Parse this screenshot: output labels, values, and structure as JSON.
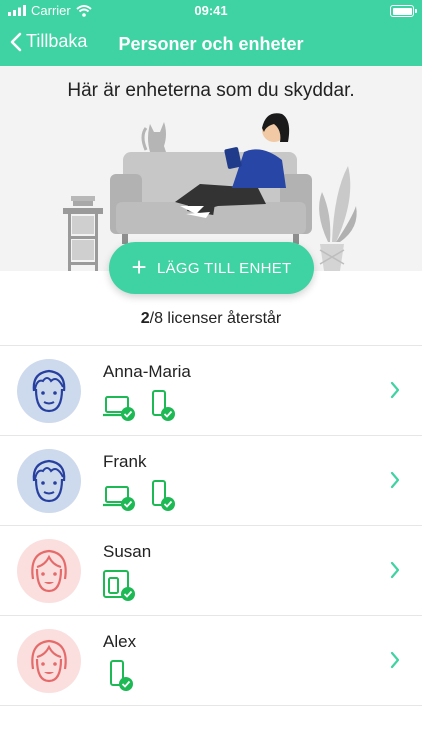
{
  "status": {
    "carrier": "Carrier",
    "time": "09:41"
  },
  "nav": {
    "back_label": "Tillbaka",
    "title": "Personer och enheter"
  },
  "hero": {
    "title": "Här är enheterna som du skyddar."
  },
  "add_button": {
    "label": "LÄGG TILL ENHET"
  },
  "licenses": {
    "used": "2",
    "rest": "/8 licenser återstår"
  },
  "colors": {
    "accent": "#3fd2a2",
    "device_green": "#1db954",
    "chevron": "#3fd2a2"
  },
  "people": [
    {
      "name": "Anna-Maria",
      "avatar": "male-avatar",
      "devices": [
        "laptop-icon",
        "phone-icon"
      ]
    },
    {
      "name": "Frank",
      "avatar": "male-avatar",
      "devices": [
        "laptop-icon",
        "phone-icon"
      ]
    },
    {
      "name": "Susan",
      "avatar": "female-avatar",
      "devices": [
        "multi-device-icon"
      ]
    },
    {
      "name": "Alex",
      "avatar": "female-avatar",
      "devices": [
        "phone-icon"
      ]
    }
  ]
}
